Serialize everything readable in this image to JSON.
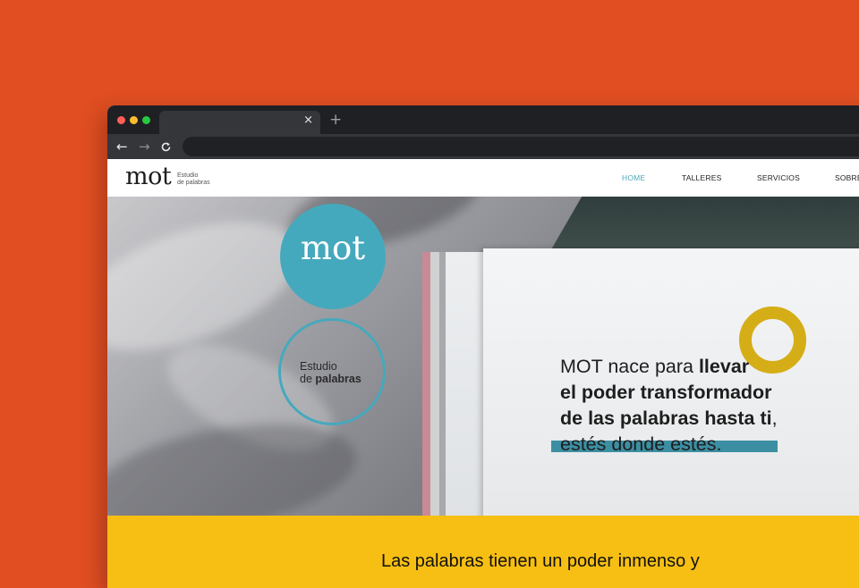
{
  "colors": {
    "background": "#e04e22",
    "accent_teal": "#45a9bd",
    "accent_yellow": "#f7bf13",
    "ring_yellow": "#d5ad16"
  },
  "browser": {
    "tab_close_icon": "close-icon",
    "new_tab_icon": "plus-icon",
    "back_icon": "arrow-left-icon",
    "forward_icon": "arrow-right-icon",
    "reload_icon": "reload-icon",
    "tab_close_glyph": "×",
    "new_tab_glyph": "+",
    "back_glyph": "←",
    "forward_glyph": "→",
    "reload_glyph": "C"
  },
  "site": {
    "logo": {
      "word": "mot",
      "sub_line1": "Estudio",
      "sub_line2": "de palabras"
    },
    "nav": [
      {
        "label": "HOME",
        "active": true
      },
      {
        "label": "TALLERES",
        "active": false
      },
      {
        "label": "SERVICIOS",
        "active": false
      },
      {
        "label": "SOBRE",
        "active": false
      }
    ]
  },
  "hero": {
    "badge_text": "mot",
    "ring_line1": "Estudio",
    "ring_line2_prefix": "de ",
    "ring_line2_bold": "palabras",
    "line1_normal": "MOT nace para ",
    "line1_bold": "llevar",
    "line2_bold": "el poder transformador",
    "line3_bold": "de las palabras hasta ti",
    "line3_suffix": ",",
    "line4": "estés donde estés."
  },
  "band": {
    "text": "Las palabras tienen un poder inmenso y"
  }
}
